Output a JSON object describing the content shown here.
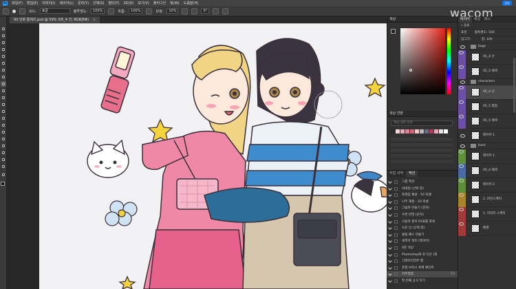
{
  "menubar": {
    "logo": "Ps",
    "items": [
      "파일(F)",
      "편집(E)",
      "이미지(I)",
      "레이어(L)",
      "문자(Y)",
      "선택(S)",
      "필터(T)",
      "3D(D)",
      "보기(V)",
      "플러그인",
      "창(W)",
      "도움말(H)"
    ],
    "share_label": "공유"
  },
  "options_bar": {
    "mode_label": "모드:",
    "mode_value": "표준",
    "opacity_label": "불투명도:",
    "opacity_value": "100%",
    "flow_label": "흐름:",
    "flow_value": "100%",
    "smooth_label": "보정:",
    "smooth_value": "10%",
    "angle_value": "0°"
  },
  "document_tab": {
    "title": "00.인화 들레즈.psd @ 59% (05_4 선, RGB/8#)",
    "close": "×"
  },
  "watermark": "wacom",
  "color_panel": {
    "title": "색상",
    "hue_color": "#e3231a"
  },
  "swatches_panel": {
    "title": "색상 견본",
    "search_placeholder": "색상 견본 검색",
    "recent_colors": [
      "#2b2b2b",
      "#f5d5d8",
      "#e8a7b3",
      "#e27f93",
      "#d1637a",
      "#f7c7c5",
      "#b9b8c3",
      "#6b6e7d",
      "#b23d5a",
      "#f2a1b8",
      "#e6e6e6",
      "#ffffff"
    ]
  },
  "actions_panel": {
    "tabs": [
      "작업 내역",
      "액션"
    ],
    "rows": [
      {
        "label": "그룹 액션",
        "selected": false
      },
      {
        "label": "비네팅 (선택 항)",
        "selected": false
      },
      {
        "label": "프레임 채널 - 50 픽셀",
        "selected": false
      },
      {
        "label": "나무 재질 - 50 픽셀",
        "selected": false
      },
      {
        "label": "그림자 만들기 (문자)",
        "selected": false
      },
      {
        "label": "수면 반영 (문자)",
        "selected": false
      },
      {
        "label": "사용자 정의 RGB를 회색",
        "selected": false
      },
      {
        "label": "녹은 납 (선택 항)",
        "selected": false
      },
      {
        "label": "클립 패스 만들기",
        "selected": false
      },
      {
        "label": "세피아 색조 (레이어)",
        "selected": false
      },
      {
        "label": "4분 색상",
        "selected": false
      },
      {
        "label": "Photoshop에 로 다운 (회",
        "selected": false
      },
      {
        "label": "그레이디언트 맵",
        "selected": false
      },
      {
        "label": "혼합 브러시 복제 페인트",
        "selected": false
      },
      {
        "label": "자주썸썸",
        "selected": true,
        "key": "F2"
      },
      {
        "label": "첫 번째 공식 하기",
        "selected": false
      }
    ]
  },
  "layers_panel": {
    "tabs": [
      "레이어",
      "채널",
      "패스"
    ],
    "kind_filter": "종류",
    "blend_mode": "표준",
    "opacity_label": "불투명도:",
    "opacity_value": "100",
    "lock_label": "잠그기:",
    "fill_label": "칠:",
    "fill_value": "100",
    "layers": [
      {
        "name": "bags",
        "type": "group",
        "visible": false
      },
      {
        "name": "05_4 선",
        "type": "layer",
        "visible": true
      },
      {
        "name": "05_5 채색",
        "type": "layer",
        "visible": true
      },
      {
        "name": "characters",
        "type": "group",
        "visible": false
      },
      {
        "name": "05_4 선",
        "type": "layer",
        "visible": true,
        "selected": true
      },
      {
        "name": "05_5 명암",
        "type": "layer",
        "visible": true
      },
      {
        "name": "05_5 채색",
        "type": "layer",
        "visible": true
      },
      {
        "name": "레이어 1",
        "type": "layer",
        "visible": false
      },
      {
        "name": "back",
        "type": "group",
        "visible": false
      },
      {
        "name": "레이어 1",
        "type": "layer",
        "visible": true
      },
      {
        "name": "05_4 채색",
        "type": "layer",
        "visible": true
      },
      {
        "name": "레이어 2",
        "type": "layer",
        "visible": true
      },
      {
        "name": "2. 라인스케치",
        "type": "layer",
        "visible": true
      },
      {
        "name": "1. 이미지 스케치",
        "type": "layer",
        "visible": true
      },
      {
        "name": "배경",
        "type": "layer",
        "visible": true
      }
    ]
  },
  "accent_colors": {
    "eye_blue": "#4a6aa3",
    "eye_green": "#5f8f3a",
    "eye_purple": "#6a4fa3",
    "eye_gold": "#a8842a",
    "eye_red": "#a33a3a"
  }
}
